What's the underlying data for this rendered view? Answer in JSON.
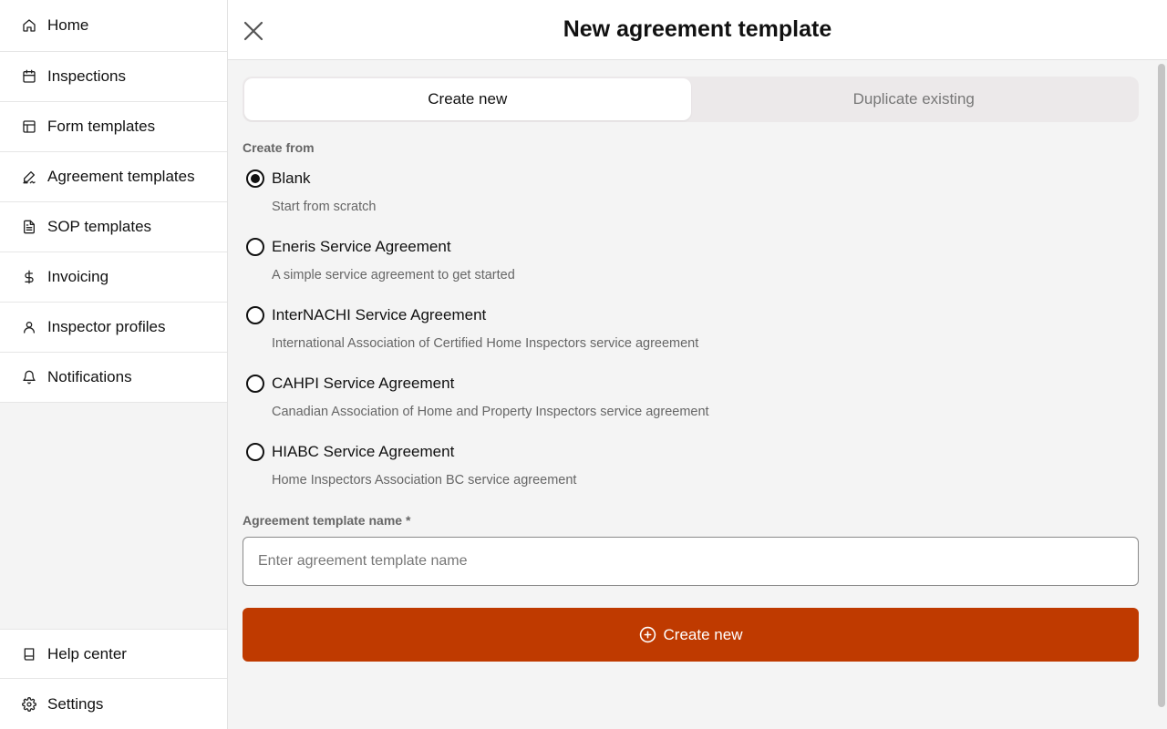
{
  "sidebar": {
    "items": [
      {
        "label": "Home",
        "icon": "home-icon"
      },
      {
        "label": "Inspections",
        "icon": "calendar-icon"
      },
      {
        "label": "Form templates",
        "icon": "layout-icon"
      },
      {
        "label": "Agreement templates",
        "icon": "signature-icon"
      },
      {
        "label": "SOP templates",
        "icon": "document-icon"
      },
      {
        "label": "Invoicing",
        "icon": "dollar-icon"
      },
      {
        "label": "Inspector profiles",
        "icon": "user-icon"
      },
      {
        "label": "Notifications",
        "icon": "bell-icon"
      }
    ],
    "bottom_items": [
      {
        "label": "Help center",
        "icon": "book-icon"
      },
      {
        "label": "Settings",
        "icon": "gear-icon"
      }
    ]
  },
  "header": {
    "title": "New agreement template",
    "close_icon": "close-icon"
  },
  "tabs": [
    {
      "label": "Create new",
      "active": true
    },
    {
      "label": "Duplicate existing",
      "active": false
    }
  ],
  "create_from": {
    "label": "Create from",
    "options": [
      {
        "title": "Blank",
        "description": "Start from scratch",
        "selected": true
      },
      {
        "title": "Eneris Service Agreement",
        "description": "A simple service agreement to get started",
        "selected": false
      },
      {
        "title": "InterNACHI Service Agreement",
        "description": "International Association of Certified Home Inspectors service agreement",
        "selected": false
      },
      {
        "title": "CAHPI Service Agreement",
        "description": "Canadian Association of Home and Property Inspectors service agreement",
        "selected": false
      },
      {
        "title": "HIABC Service Agreement",
        "description": "Home Inspectors Association BC service agreement",
        "selected": false
      }
    ]
  },
  "name_field": {
    "label": "Agreement template name *",
    "placeholder": "Enter agreement template name",
    "value": ""
  },
  "submit": {
    "label": "Create new",
    "icon": "plus-circle-icon",
    "color": "#bf3a00"
  }
}
